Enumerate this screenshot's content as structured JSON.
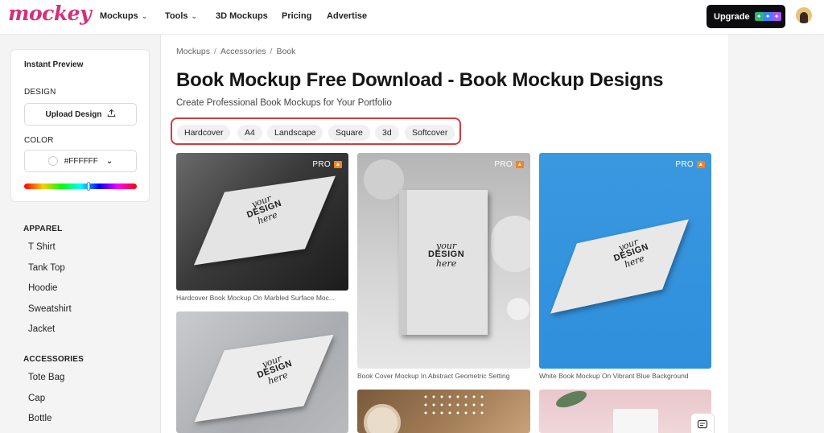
{
  "header": {
    "logo": "mockey",
    "nav": [
      {
        "label": "Mockups",
        "dropdown": true
      },
      {
        "label": "Tools",
        "dropdown": true
      },
      {
        "label": "3D Mockups",
        "dropdown": false
      },
      {
        "label": "Pricing",
        "dropdown": false
      },
      {
        "label": "Advertise",
        "dropdown": false
      }
    ],
    "upgrade_label": "Upgrade"
  },
  "sidebar": {
    "preview_title": "Instant Preview",
    "design_label": "DESIGN",
    "upload_label": "Upload Design",
    "color_label": "COLOR",
    "color_value": "#FFFFFF",
    "categories": [
      {
        "title": "APPAREL",
        "items": [
          "T Shirt",
          "Tank Top",
          "Hoodie",
          "Sweatshirt",
          "Jacket"
        ]
      },
      {
        "title": "ACCESSORIES",
        "items": [
          "Tote Bag",
          "Cap",
          "Bottle"
        ]
      }
    ]
  },
  "main": {
    "breadcrumb": [
      "Mockups",
      "Accessories",
      "Book"
    ],
    "title": "Book Mockup Free Download - Book Mockup Designs",
    "subtitle": "Create Professional Book Mockups for Your Portfolio",
    "tags": [
      "Hardcover",
      "A4",
      "Landscape",
      "Square",
      "3d",
      "Softcover"
    ],
    "book_text": {
      "line1": "your",
      "line2": "DESIGN",
      "line3": "here"
    },
    "cards": [
      {
        "badge": "PRO",
        "caption": "Hardcover Book Mockup On Marbled Surface Moc..."
      },
      {
        "badge": "PRO",
        "caption": "Book Cover Mockup In Abstract Geometric Setting"
      },
      {
        "badge": "PRO",
        "caption": "White Book Mockup On Vibrant Blue Background"
      },
      {
        "badge": "",
        "caption": ""
      },
      {
        "badge": "",
        "caption": ""
      },
      {
        "badge": "",
        "caption": ""
      }
    ]
  },
  "colors": {
    "brand": "#d4307a",
    "highlight_border": "#d33b3b",
    "pro_icon": "#f5821f",
    "upgrade_bg": "#0d0d0f"
  }
}
